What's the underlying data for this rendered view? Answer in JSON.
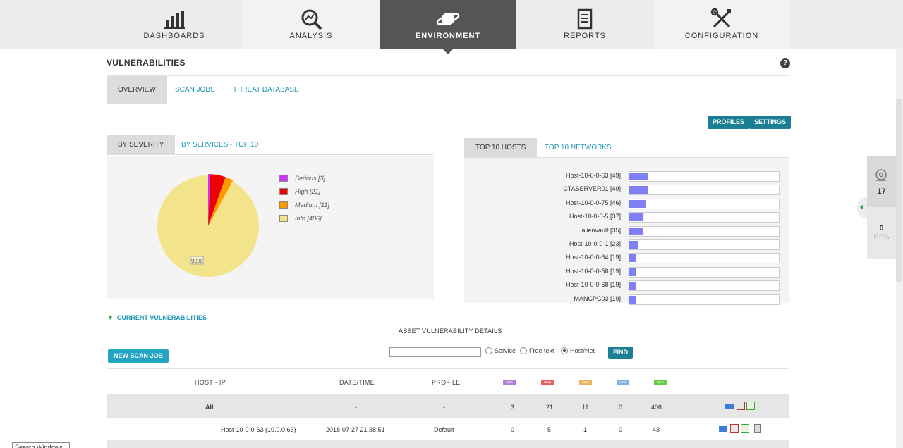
{
  "nav": {
    "items": [
      {
        "label": "DASHBOARDS",
        "icon": "bar-chart-icon"
      },
      {
        "label": "ANALYSIS",
        "icon": "magnifier-chart-icon"
      },
      {
        "label": "ENVIRONMENT",
        "icon": "planet-icon"
      },
      {
        "label": "REPORTS",
        "icon": "document-icon"
      },
      {
        "label": "CONFIGURATION",
        "icon": "tools-icon"
      }
    ],
    "active": "ENVIRONMENT"
  },
  "page": {
    "title": "VULNERABILITIES",
    "help": "?",
    "subtabs": [
      "OVERVIEW",
      "SCAN JOBS",
      "THREAT DATABASE"
    ],
    "buttons": {
      "profiles": "PROFILES",
      "settings": "SETTINGS"
    }
  },
  "severity_panel": {
    "tabs": [
      "BY SEVERITY",
      "BY SERVICES - TOP 10"
    ],
    "legend": [
      {
        "label": "Serious [3]",
        "color": "#cc33ff"
      },
      {
        "label": "High [21]",
        "color": "#ee0000"
      },
      {
        "label": "Medium [11]",
        "color": "#ff9900"
      },
      {
        "label": "Info [406]",
        "color": "#f3e48c"
      }
    ],
    "pie_label": "92%"
  },
  "chart_data": [
    {
      "type": "pie",
      "title": "",
      "categories": [
        "Serious",
        "High",
        "Medium",
        "Info"
      ],
      "values": [
        3,
        21,
        11,
        406
      ],
      "colors": [
        "#cc33ff",
        "#ee0000",
        "#ff9900",
        "#f3e48c"
      ],
      "legend": "right"
    },
    {
      "type": "bar",
      "orientation": "horizontal",
      "categories": [
        "Host-10-0-0-63",
        "CTASERVER01",
        "Host-10-0-0-75",
        "Host-10-0-0-5",
        "alienvault",
        "Host-10-0-0-1",
        "Host-10-0-0-64",
        "Host-10-0-0-58",
        "Host-10-0-0-68",
        "MANCPC03"
      ],
      "values": [
        49,
        49,
        46,
        37,
        35,
        23,
        19,
        19,
        19,
        19
      ],
      "color": "#8080f5"
    }
  ],
  "hosts_panel": {
    "tabs": [
      "TOP 10 HOSTS",
      "TOP 10 NETWORKS"
    ],
    "rows": [
      {
        "label": "Host-10-0-0-63 [49]",
        "value": 49
      },
      {
        "label": "CTASERVER01 [49]",
        "value": 49
      },
      {
        "label": "Host-10-0-0-75 [46]",
        "value": 46
      },
      {
        "label": "Host-10-0-0-5 [37]",
        "value": 37
      },
      {
        "label": "alienvault [35]",
        "value": 35
      },
      {
        "label": "Host-10-0-0-1 [23]",
        "value": 23
      },
      {
        "label": "Host-10-0-0-64 [19]",
        "value": 19
      },
      {
        "label": "Host-10-0-0-58 [19]",
        "value": 19
      },
      {
        "label": "Host-10-0-0-68 [19]",
        "value": 19
      },
      {
        "label": "MANCPC03 [19]",
        "value": 19
      }
    ],
    "max": 400
  },
  "current": {
    "title": "CURRENT VULNERABILITIES",
    "asset_title": "ASSET VULNERABILITY DETAILS",
    "new_scan": "NEW SCAN JOB",
    "find": "FIND",
    "radios": [
      {
        "label": "Service",
        "checked": false
      },
      {
        "label": "Free text",
        "checked": false
      },
      {
        "label": "Host/Net",
        "checked": true
      }
    ]
  },
  "table": {
    "headers": {
      "host": "HOST - IP",
      "date": "DATE/TIME",
      "profile": "PROFILE"
    },
    "badges": [
      {
        "label": "SERI",
        "color": "#b07fd8"
      },
      {
        "label": "HIGH",
        "color": "#e86060"
      },
      {
        "label": "MED",
        "color": "#f0b060"
      },
      {
        "label": "LOW",
        "color": "#7fb0e0"
      },
      {
        "label": "INFO",
        "color": "#66cc44"
      }
    ],
    "rows": [
      {
        "host": "All",
        "date": "-",
        "profile": "-",
        "serious": "3",
        "high": "21",
        "medium": "11",
        "low": "0",
        "info": "406"
      },
      {
        "host": "Host-10-0-0-63 (10.0.0.63)",
        "date": "2018-07-27 21:38:51",
        "profile": "Default",
        "serious": "0",
        "high": "5",
        "medium": "1",
        "low": "0",
        "info": "43"
      }
    ]
  },
  "side": {
    "top_value": "17",
    "bottom_value": "0",
    "bottom_unit": "EPS"
  },
  "taskbar": {
    "label": "Search Windows"
  }
}
